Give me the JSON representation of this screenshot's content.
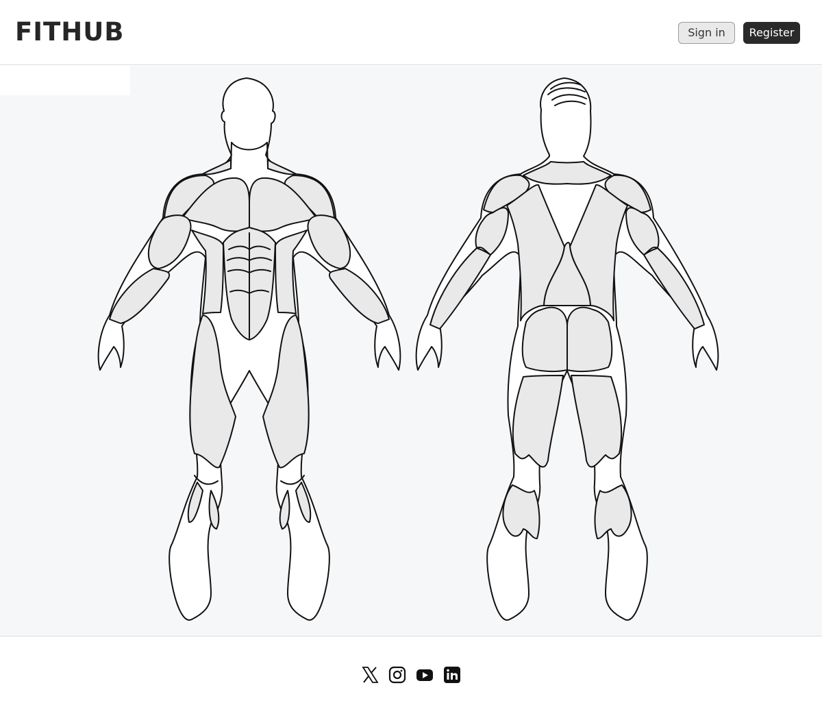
{
  "header": {
    "logo_text": "FITHUB",
    "signin_label": "Sign in",
    "register_label": "Register"
  },
  "figures": [
    "front-view",
    "back-view"
  ],
  "footer": {
    "icons": [
      "x-icon",
      "instagram-icon",
      "youtube-icon",
      "linkedin-icon"
    ]
  },
  "colors": {
    "muscle_fill": "#e9e9e9",
    "stage_background": "#f6f7f9",
    "register_button": "#2a2a2a"
  }
}
